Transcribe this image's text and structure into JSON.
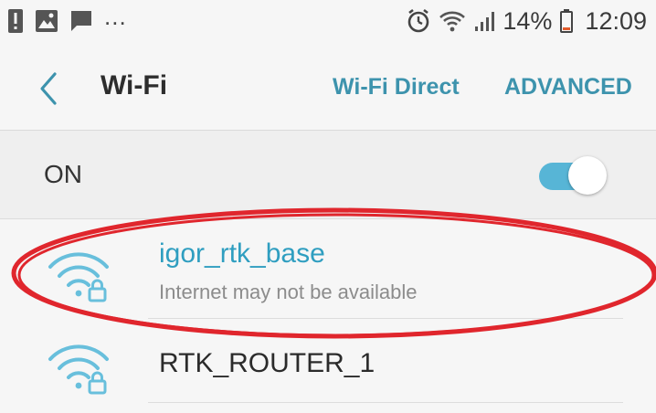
{
  "status_bar": {
    "left_icons": [
      "alert-icon",
      "image-icon",
      "message-icon"
    ],
    "more": "...",
    "battery": "14%",
    "time": "12:09"
  },
  "header": {
    "title": "Wi-Fi",
    "wifi_direct": "Wi-Fi Direct",
    "advanced": "ADVANCED"
  },
  "toggle": {
    "label": "ON",
    "state": true
  },
  "networks": [
    {
      "name": "igor_rtk_base",
      "status": "Internet may not be available",
      "connected": true
    },
    {
      "name": "RTK_ROUTER_1",
      "status": "",
      "connected": false
    }
  ],
  "colors": {
    "accent": "#3d93ad",
    "toggle_on": "#57b5d6",
    "connected_name": "#2f9ec0",
    "annotation": "#e0262d",
    "background": "#f6f6f6"
  }
}
